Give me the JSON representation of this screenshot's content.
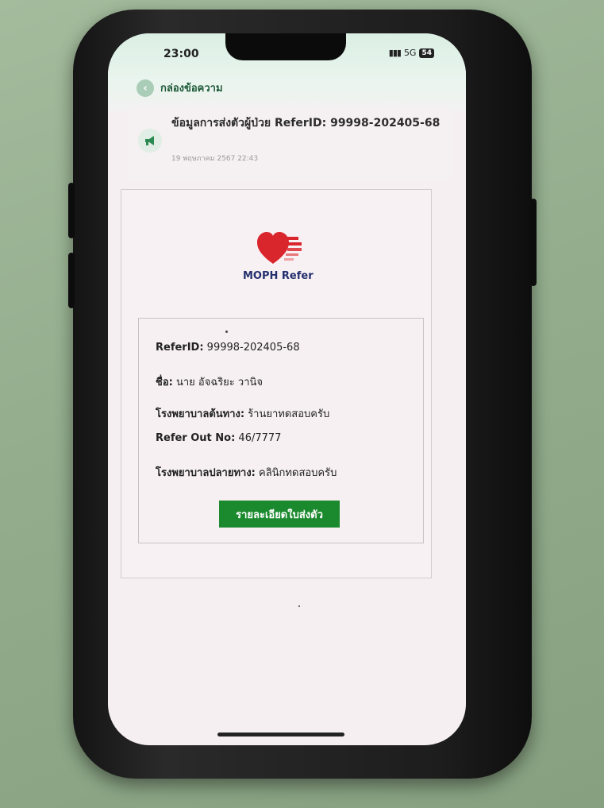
{
  "status_bar": {
    "time": "23:00",
    "network": "5G",
    "battery": "54"
  },
  "nav": {
    "back_icon": "chevron-left-icon",
    "title": "กล่องข้อความ"
  },
  "message": {
    "icon": "megaphone-icon",
    "title": "ข้อมูลการส่งตัวผู้ป่วย ReferID: 99998-202405-68",
    "date": "19 พฤษภาคม 2567 22:43"
  },
  "card": {
    "logo_text": "MOPH Refer",
    "fields": [
      {
        "label": "ReferID:",
        "value": " 99998-202405-68"
      },
      {
        "label": "ชื่อ:",
        "value": " นาย อัจฉริยะ วานิจ"
      },
      {
        "label": "โรงพยาบาลต้นทาง:",
        "value": " ร้านยาทดสอบครับ"
      },
      {
        "label": "Refer Out No:",
        "value": " 46/7777"
      },
      {
        "label": "โรงพยาบาลปลายทาง:",
        "value": " คลินิกทดสอบครับ"
      }
    ],
    "detail_button": "รายละเอียดใบส่งตัว"
  },
  "colors": {
    "accent_green": "#1b8a2e",
    "logo_red": "#d9262c",
    "logo_navy": "#232f6e"
  }
}
